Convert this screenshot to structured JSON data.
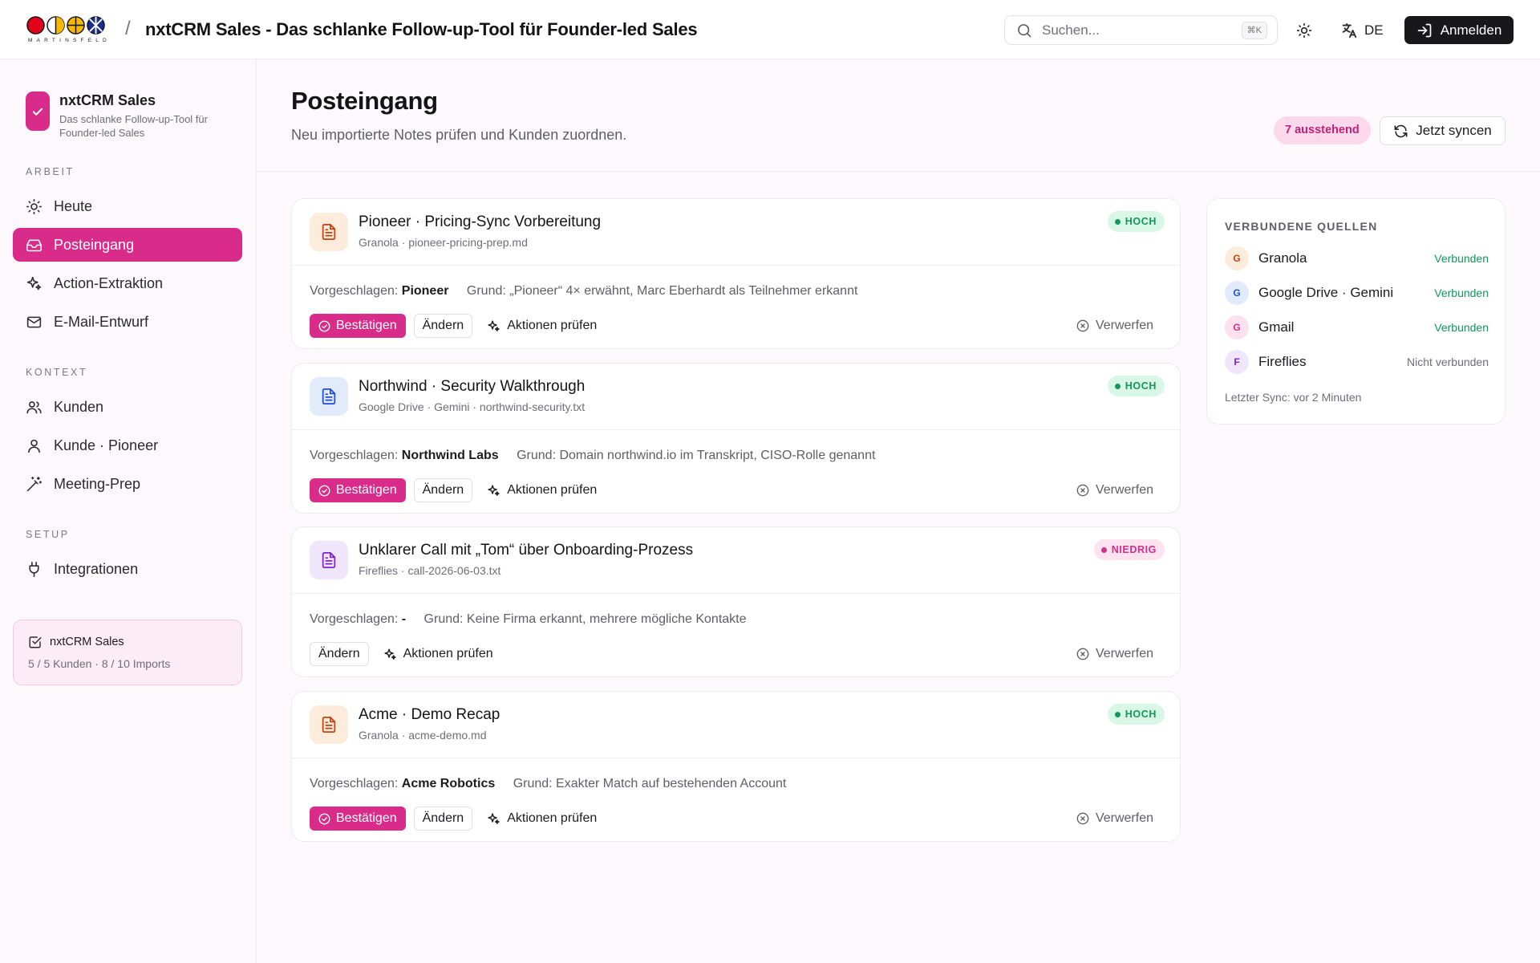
{
  "header": {
    "logo_word": "MARTINSFELD",
    "breadcrumb_separator": "/",
    "title": "nxtCRM Sales - Das schlanke Follow-up-Tool für Founder-led Sales",
    "search_placeholder": "Suchen...",
    "search_shortcut": "⌘K",
    "language": "DE",
    "login_label": "Anmelden"
  },
  "sidebar": {
    "brand_name": "nxtCRM Sales",
    "brand_subtitle": "Das schlanke Follow-up-Tool für Founder-led Sales",
    "sections": [
      {
        "title": "ARBEIT",
        "items": [
          {
            "label": "Heute",
            "icon": "sun-icon"
          },
          {
            "label": "Posteingang",
            "icon": "inbox-icon",
            "active": true
          },
          {
            "label": "Action-Extraktion",
            "icon": "sparkles-icon"
          },
          {
            "label": "E-Mail-Entwurf",
            "icon": "mail-icon"
          }
        ]
      },
      {
        "title": "KONTEXT",
        "items": [
          {
            "label": "Kunden",
            "icon": "users-icon"
          },
          {
            "label": "Kunde · Pioneer",
            "icon": "user-icon"
          },
          {
            "label": "Meeting-Prep",
            "icon": "magic-wand-icon"
          }
        ]
      },
      {
        "title": "SETUP",
        "items": [
          {
            "label": "Integrationen",
            "icon": "plug-icon"
          }
        ]
      }
    ],
    "plan": {
      "title": "nxtCRM Sales",
      "usage": "5 / 5 Kunden · 8 / 10 Imports"
    }
  },
  "page": {
    "title": "Posteingang",
    "subtitle": "Neu importierte Notes prüfen und Kunden zuordnen.",
    "pending_badge": "7 ausstehend",
    "sync_label": "Jetzt syncen"
  },
  "labels": {
    "suggested": "Vorgeschlagen:",
    "confirm": "Bestätigen",
    "change": "Ändern",
    "review_actions": "Aktionen prüfen",
    "discard": "Verwerfen"
  },
  "inbox": [
    {
      "title": "Pioneer · Pricing-Sync Vorbereitung",
      "meta": "Granola · pioneer-pricing-prep.md",
      "priority": "HOCH",
      "suggested": "Pioneer",
      "reason": "Grund: „Pioneer“ 4× erwähnt, Marc Eberhardt als Teilnehmer erkannt",
      "source_color": "#c2410c",
      "source_bg": "#fdecdc",
      "can_confirm": true
    },
    {
      "title": "Northwind · Security Walkthrough",
      "meta": "Google Drive · Gemini · northwind-security.txt",
      "priority": "HOCH",
      "suggested": "Northwind Labs",
      "reason": "Grund: Domain northwind.io im Transkript, CISO-Rolle genannt",
      "source_color": "#1d4ed8",
      "source_bg": "#e2ebfc",
      "can_confirm": true
    },
    {
      "title": "Unklarer Call mit „Tom“ über Onboarding-Prozess",
      "meta": "Fireflies · call-2026-06-03.txt",
      "priority": "NIEDRIG",
      "suggested": "-",
      "reason": "Grund: Keine Firma erkannt, mehrere mögliche Kontakte",
      "source_color": "#7e22ce",
      "source_bg": "#efe6fb",
      "can_confirm": false
    },
    {
      "title": "Acme · Demo Recap",
      "meta": "Granola · acme-demo.md",
      "priority": "HOCH",
      "suggested": "Acme Robotics",
      "reason": "Grund: Exakter Match auf bestehenden Account",
      "source_color": "#c2410c",
      "source_bg": "#fdecdc",
      "can_confirm": true
    }
  ],
  "sources": {
    "title": "VERBUNDENE QUELLEN",
    "items": [
      {
        "initial": "G",
        "name": "Granola",
        "status": "Verbunden",
        "connected": true,
        "color": "#c2410c",
        "bg": "#fdecdc"
      },
      {
        "initial": "G",
        "name": "Google Drive · Gemini",
        "status": "Verbunden",
        "connected": true,
        "color": "#1d4ed8",
        "bg": "#e2ebfc"
      },
      {
        "initial": "G",
        "name": "Gmail",
        "status": "Verbunden",
        "connected": true,
        "color": "#d92b8a",
        "bg": "#fbe1ee"
      },
      {
        "initial": "F",
        "name": "Fireflies",
        "status": "Nicht verbunden",
        "connected": false,
        "color": "#7e22ce",
        "bg": "#efe6fb"
      }
    ],
    "last_sync": "Letzter Sync: vor 2 Minuten"
  },
  "colors": {
    "accent": "#d92b8a",
    "success": "#15965a",
    "dark": "#18181b"
  }
}
